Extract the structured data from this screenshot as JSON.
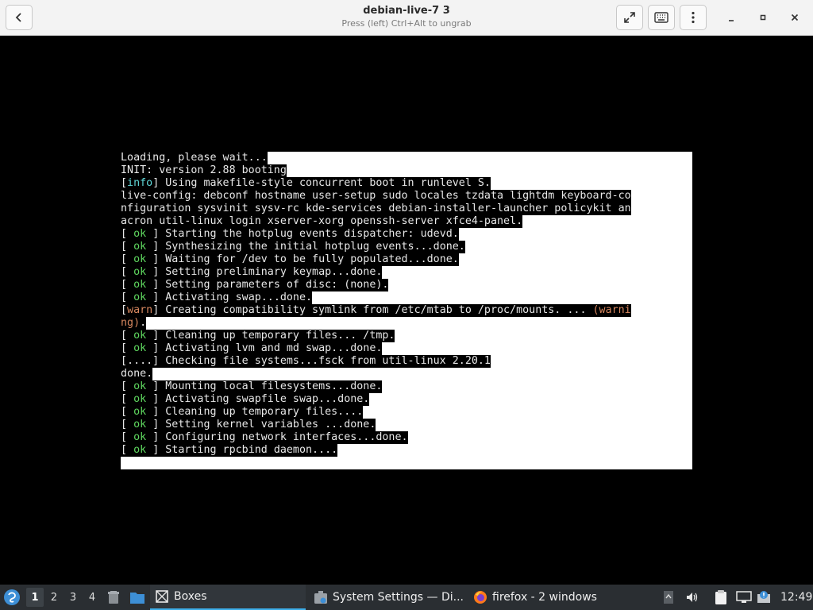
{
  "window": {
    "title": "debian-live-7 3",
    "subtitle": "Press (left) Ctrl+Alt to ungrab",
    "back_icon": "back-arrow-icon",
    "fullscreen_icon": "fullscreen-icon",
    "keyboard_icon": "keyboard-icon",
    "menu_icon": "kebab-menu-icon",
    "minimize_icon": "minimize-icon",
    "maximize_icon": "maximize-icon",
    "close_icon": "close-icon"
  },
  "console": {
    "lines": [
      [
        {
          "t": "Loading, please wait...",
          "c": "w"
        }
      ],
      [
        {
          "t": "INIT: version 2.88 booting",
          "c": "w"
        }
      ],
      [
        {
          "t": "[",
          "c": "w"
        },
        {
          "t": "info",
          "c": "info"
        },
        {
          "t": "] Using makefile-style concurrent boot in runlevel S.",
          "c": "w"
        }
      ],
      [
        {
          "t": "live-config: debconf hostname user-setup sudo locales tzdata lightdm keyboard-co",
          "c": "w"
        }
      ],
      [
        {
          "t": "nfiguration sysvinit sysv-rc kde-services debian-installer-launcher policykit an",
          "c": "w"
        }
      ],
      [
        {
          "t": "acron util-linux login xserver-xorg openssh-server xfce4-panel.",
          "c": "w"
        }
      ],
      [
        {
          "t": "[ ",
          "c": "w"
        },
        {
          "t": "ok",
          "c": "ok"
        },
        {
          "t": " ] Starting the hotplug events dispatcher: udevd.",
          "c": "w"
        }
      ],
      [
        {
          "t": "[ ",
          "c": "w"
        },
        {
          "t": "ok",
          "c": "ok"
        },
        {
          "t": " ] Synthesizing the initial hotplug events...done.",
          "c": "w"
        }
      ],
      [
        {
          "t": "[ ",
          "c": "w"
        },
        {
          "t": "ok",
          "c": "ok"
        },
        {
          "t": " ] Waiting for /dev to be fully populated...done.",
          "c": "w"
        }
      ],
      [
        {
          "t": "[ ",
          "c": "w"
        },
        {
          "t": "ok",
          "c": "ok"
        },
        {
          "t": " ] Setting preliminary keymap...done.",
          "c": "w"
        }
      ],
      [
        {
          "t": "[ ",
          "c": "w"
        },
        {
          "t": "ok",
          "c": "ok"
        },
        {
          "t": " ] Setting parameters of disc: (none).",
          "c": "w"
        }
      ],
      [
        {
          "t": "[ ",
          "c": "w"
        },
        {
          "t": "ok",
          "c": "ok"
        },
        {
          "t": " ] Activating swap...done.",
          "c": "w"
        }
      ],
      [
        {
          "t": "[",
          "c": "w"
        },
        {
          "t": "warn",
          "c": "warn"
        },
        {
          "t": "] Creating compatibility symlink from /etc/mtab to /proc/mounts. ... ",
          "c": "w"
        },
        {
          "t": "(warni",
          "c": "warn"
        }
      ],
      [
        {
          "t": "ng)",
          "c": "warn"
        },
        {
          "t": ".",
          "c": "w"
        }
      ],
      [
        {
          "t": "[ ",
          "c": "w"
        },
        {
          "t": "ok",
          "c": "ok"
        },
        {
          "t": " ] Cleaning up temporary files... /tmp.",
          "c": "w"
        }
      ],
      [
        {
          "t": "[ ",
          "c": "w"
        },
        {
          "t": "ok",
          "c": "ok"
        },
        {
          "t": " ] Activating lvm and md swap...done.",
          "c": "w"
        }
      ],
      [
        {
          "t": "[....] Checking file systems...fsck from util-linux 2.20.1",
          "c": "w"
        }
      ],
      [
        {
          "t": "done.",
          "c": "w"
        }
      ],
      [
        {
          "t": "[ ",
          "c": "w"
        },
        {
          "t": "ok",
          "c": "ok"
        },
        {
          "t": " ] Mounting local filesystems...done.",
          "c": "w"
        }
      ],
      [
        {
          "t": "[ ",
          "c": "w"
        },
        {
          "t": "ok",
          "c": "ok"
        },
        {
          "t": " ] Activating swapfile swap...done.",
          "c": "w"
        }
      ],
      [
        {
          "t": "[ ",
          "c": "w"
        },
        {
          "t": "ok",
          "c": "ok"
        },
        {
          "t": " ] Cleaning up temporary files....",
          "c": "w"
        }
      ],
      [
        {
          "t": "[ ",
          "c": "w"
        },
        {
          "t": "ok",
          "c": "ok"
        },
        {
          "t": " ] Setting kernel variables ...done.",
          "c": "w"
        }
      ],
      [
        {
          "t": "[ ",
          "c": "w"
        },
        {
          "t": "ok",
          "c": "ok"
        },
        {
          "t": " ] Configuring network interfaces...done.",
          "c": "w"
        }
      ],
      [
        {
          "t": "[ ",
          "c": "w"
        },
        {
          "t": "ok",
          "c": "ok"
        },
        {
          "t": " ] Starting rpcbind daemon....",
          "c": "w"
        }
      ]
    ]
  },
  "taskbar": {
    "launcher_icon": "application-launcher-icon",
    "desktops": [
      "1",
      "2",
      "3",
      "4"
    ],
    "active_desktop": "1",
    "tasks": [
      {
        "label": "Boxes",
        "icon": "boxes-icon",
        "active": true
      },
      {
        "label": "System Settings — Di...",
        "icon": "system-settings-icon",
        "active": false
      },
      {
        "label": "firefox - 2 windows",
        "icon": "firefox-icon",
        "active": false
      }
    ],
    "clock": "12:49"
  },
  "colors": {
    "ok": "#5fd75f",
    "info": "#5fd7d7",
    "warn": "#d7875f",
    "taskbar_bg": "#2a2e32",
    "accent": "#3daee9"
  }
}
